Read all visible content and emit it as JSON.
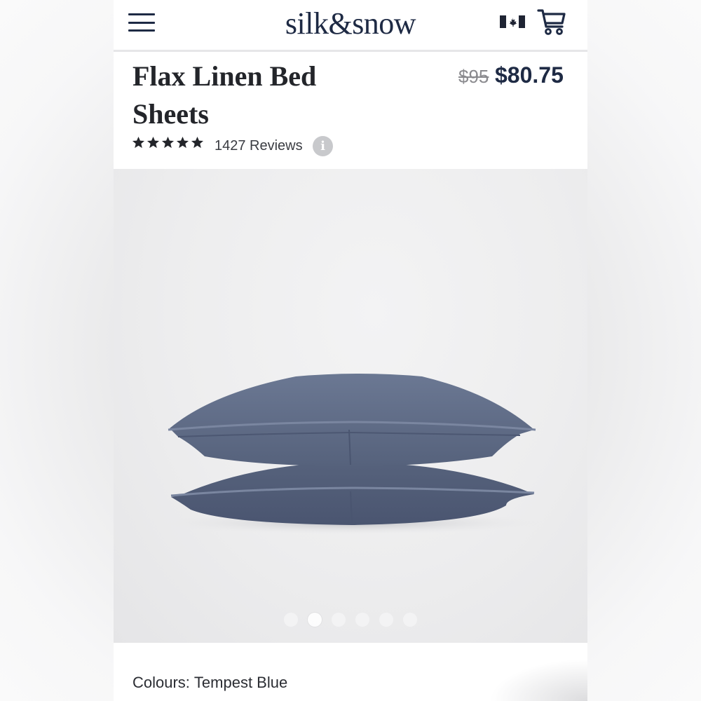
{
  "header": {
    "logo": "silk&snow",
    "menu_icon": "hamburger-icon",
    "flag_icon": "canada-flag-icon",
    "cart_icon": "cart-icon"
  },
  "product": {
    "title_line1": "Flax Linen Bed",
    "title_line2": "Sheets",
    "price_original": "$95",
    "price_sale": "$80.75",
    "rating": 5,
    "rating_max": 5,
    "reviews": "1427 Reviews",
    "info_icon": "info-icon",
    "colour_label": "Colours:",
    "colour_value": "Tempest Blue"
  },
  "carousel": {
    "slide_count": 6,
    "active_index": 1,
    "image": "pillows-photo"
  },
  "colors": {
    "brand_navy": "#1e2a44",
    "pillow": "#5f6c87"
  }
}
